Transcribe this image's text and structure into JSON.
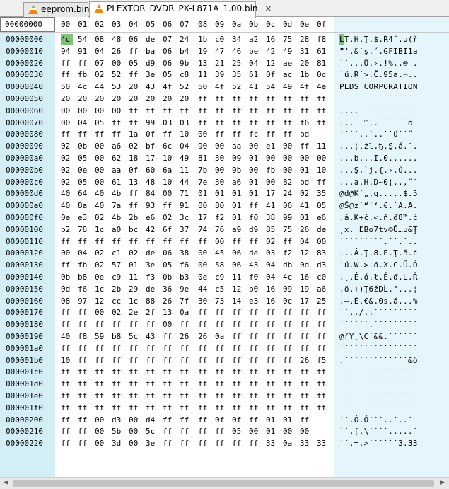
{
  "tabs": [
    {
      "label": "eeprom.bin",
      "icon": "vlc-cone-icon",
      "active": false
    },
    {
      "label": "PLEXTOR_DVDR_PX-L871A_1.00.bin",
      "icon": "vlc-cone-icon",
      "active": true,
      "close": "×"
    }
  ],
  "header": {
    "offset_label": "00000000",
    "columns": [
      "00",
      "01",
      "02",
      "03",
      "04",
      "05",
      "06",
      "07",
      "08",
      "09",
      "0a",
      "0b",
      "0c",
      "0d",
      "0e",
      "0f"
    ]
  },
  "cursor": {
    "row": 0,
    "col": 0
  },
  "rows": [
    {
      "offset": "00000000",
      "hex": [
        "4c",
        "54",
        "08",
        "48",
        "06",
        "de",
        "07",
        "24",
        "1b",
        "c0",
        "34",
        "a2",
        "16",
        "75",
        "28",
        "f8"
      ],
      "ascii": "LT.H.Ţ.$.Ŕ4˘.u(ř"
    },
    {
      "offset": "00000010",
      "hex": [
        "94",
        "91",
        "04",
        "26",
        "ff",
        "ba",
        "06",
        "b4",
        "19",
        "47",
        "46",
        "be",
        "42",
        "49",
        "31",
        "61"
      ],
      "ascii": "”‘.&˙ş.´.GFIBI1a"
    },
    {
      "offset": "00000020",
      "hex": [
        "ff",
        "ff",
        "07",
        "00",
        "05",
        "d9",
        "06",
        "9b",
        "13",
        "21",
        "25",
        "04",
        "12",
        "ae",
        "20",
        "81"
      ],
      "ascii": "˙˙...Ů.›.!%..® ."
    },
    {
      "offset": "00000030",
      "hex": [
        "ff",
        "fb",
        "02",
        "52",
        "ff",
        "3e",
        "05",
        "c8",
        "11",
        "39",
        "35",
        "61",
        "0f",
        "ac",
        "1b",
        "0c"
      ],
      "ascii": "˙ű.R˙>.Č.95a.¬.."
    },
    {
      "offset": "00000040",
      "hex": [
        "50",
        "4c",
        "44",
        "53",
        "20",
        "43",
        "4f",
        "52",
        "50",
        "4f",
        "52",
        "41",
        "54",
        "49",
        "4f",
        "4e"
      ],
      "ascii": "PLDS CORPORATION"
    },
    {
      "offset": "00000050",
      "hex": [
        "20",
        "20",
        "20",
        "20",
        "20",
        "20",
        "20",
        "20",
        "ff",
        "ff",
        "ff",
        "ff",
        "ff",
        "ff",
        "ff",
        "ff"
      ],
      "ascii": "        ˙˙˙˙˙˙˙˙"
    },
    {
      "offset": "00000060",
      "hex": [
        "00",
        "00",
        "00",
        "00",
        "ff",
        "ff",
        "ff",
        "ff",
        "ff",
        "ff",
        "ff",
        "ff",
        "ff",
        "ff",
        "ff",
        "ff"
      ],
      "ascii": "....˙˙˙˙˙˙˙˙˙˙˙˙"
    },
    {
      "offset": "00000070",
      "hex": [
        "00",
        "04",
        "05",
        "ff",
        "ff",
        "99",
        "03",
        "03",
        "ff",
        "ff",
        "ff",
        "ff",
        "ff",
        "ff",
        "f6",
        "ff"
      ],
      "ascii": "...˙˙™..˙˙˙˙˙˙ö˙"
    },
    {
      "offset": "00000080",
      "hex": [
        "ff",
        "ff",
        "ff",
        "ff",
        "1a",
        "0f",
        "ff",
        "10",
        "00",
        "ff",
        "ff",
        "fc",
        "ff",
        "ff",
        "bd"
      ],
      "ascii": "˙˙˙˙..˙..˙˙ü˙˙˝"
    },
    {
      "offset": "00000090",
      "hex": [
        "02",
        "0b",
        "00",
        "a6",
        "02",
        "bf",
        "6c",
        "04",
        "90",
        "00",
        "aa",
        "00",
        "e1",
        "00",
        "ff",
        "11"
      ],
      "ascii": "...¦.żl.ђ.Ş.á.˙."
    },
    {
      "offset": "000000a0",
      "hex": [
        "02",
        "05",
        "00",
        "62",
        "18",
        "17",
        "10",
        "49",
        "81",
        "30",
        "09",
        "01",
        "00",
        "00",
        "00",
        "00"
      ],
      "ascii": "...b...I.0......"
    },
    {
      "offset": "000000b0",
      "hex": [
        "02",
        "0e",
        "00",
        "aa",
        "0f",
        "60",
        "6a",
        "11",
        "7b",
        "00",
        "9b",
        "00",
        "fb",
        "00",
        "01",
        "10"
      ],
      "ascii": "...Ş.`j.{.›.ű..."
    },
    {
      "offset": "000000c0",
      "hex": [
        "02",
        "05",
        "00",
        "61",
        "13",
        "48",
        "10",
        "44",
        "7e",
        "30",
        "a6",
        "01",
        "00",
        "82",
        "bd",
        "ff"
      ],
      "ascii": "...a.H.D~0¦..‚˝˙"
    },
    {
      "offset": "000000d0",
      "hex": [
        "40",
        "64",
        "40",
        "4b",
        "ff",
        "84",
        "00",
        "71",
        "01",
        "01",
        "01",
        "01",
        "17",
        "24",
        "02",
        "35"
      ],
      "ascii": "@d@K˙„.q.....$.5"
    },
    {
      "offset": "000000e0",
      "hex": [
        "40",
        "8a",
        "40",
        "7a",
        "ff",
        "93",
        "ff",
        "91",
        "00",
        "80",
        "01",
        "ff",
        "41",
        "06",
        "41",
        "05"
      ],
      "ascii": "@Š@z˙“˙‘.€.˙A.A."
    },
    {
      "offset": "000000f0",
      "hex": [
        "0e",
        "e3",
        "02",
        "4b",
        "2b",
        "e6",
        "02",
        "3c",
        "17",
        "f2",
        "01",
        "f0",
        "38",
        "99",
        "01",
        "e6"
      ],
      "ascii": ".ă.K+ć.<.ň.đ8™.ć"
    },
    {
      "offset": "00000100",
      "hex": [
        "b2",
        "78",
        "1c",
        "a0",
        "bc",
        "42",
        "6f",
        "37",
        "74",
        "76",
        "a9",
        "d9",
        "85",
        "75",
        "26",
        "de"
      ],
      "ascii": "˛x. ĽBo7tv©Ů…u&Ţ"
    },
    {
      "offset": "00000110",
      "hex": [
        "ff",
        "ff",
        "ff",
        "ff",
        "ff",
        "ff",
        "ff",
        "ff",
        "ff",
        "00",
        "ff",
        "ff",
        "02",
        "ff",
        "04",
        "00"
      ],
      "ascii": "˙˙˙˙˙˙˙˙˙.˙˙.˙.."
    },
    {
      "offset": "00000120",
      "hex": [
        "00",
        "04",
        "02",
        "c1",
        "02",
        "de",
        "06",
        "38",
        "00",
        "45",
        "06",
        "de",
        "03",
        "f2",
        "12",
        "83"
      ],
      "ascii": "...Á.Ţ.8.E.Ţ.ň.ѓ"
    },
    {
      "offset": "00000130",
      "hex": [
        "ff",
        "fb",
        "02",
        "57",
        "01",
        "3e",
        "05",
        "f6",
        "00",
        "58",
        "06",
        "43",
        "04",
        "db",
        "0d",
        "d3"
      ],
      "ascii": "˙ű.W.>.ö.X.C.Ű.Ó"
    },
    {
      "offset": "00000140",
      "hex": [
        "0b",
        "b8",
        "0e",
        "c9",
        "11",
        "f3",
        "0b",
        "b3",
        "0e",
        "c9",
        "11",
        "f0",
        "04",
        "4c",
        "16",
        "c0"
      ],
      "ascii": ".¸.É.ó.ł.É.đ.L.Ŕ"
    },
    {
      "offset": "00000150",
      "hex": [
        "0d",
        "f6",
        "1c",
        "2b",
        "29",
        "de",
        "36",
        "9e",
        "44",
        "c5",
        "12",
        "b0",
        "16",
        "09",
        "19",
        "a6"
      ],
      "ascii": ".ö.+)Ţ6žDĹ.°...¦"
    },
    {
      "offset": "00000160",
      "hex": [
        "08",
        "97",
        "12",
        "cc",
        "1c",
        "88",
        "26",
        "7f",
        "30",
        "73",
        "14",
        "e3",
        "16",
        "0c",
        "17",
        "25"
      ],
      "ascii": ".—.Ě.€&.0s.ă...%"
    },
    {
      "offset": "00000170",
      "hex": [
        "ff",
        "ff",
        "00",
        "02",
        "2e",
        "2f",
        "13",
        "0a",
        "ff",
        "ff",
        "ff",
        "ff",
        "ff",
        "ff",
        "ff",
        "ff"
      ],
      "ascii": "˙˙../..˙˙˙˙˙˙˙˙˙"
    },
    {
      "offset": "00000180",
      "hex": [
        "ff",
        "ff",
        "ff",
        "ff",
        "ff",
        "ff",
        "00",
        "ff",
        "ff",
        "ff",
        "ff",
        "ff",
        "ff",
        "ff",
        "ff",
        "ff"
      ],
      "ascii": "˙˙˙˙˙˙.˙˙˙˙˙˙˙˙˙"
    },
    {
      "offset": "00000190",
      "hex": [
        "40",
        "f8",
        "59",
        "b8",
        "5c",
        "43",
        "ff",
        "26",
        "26",
        "0a",
        "ff",
        "ff",
        "ff",
        "ff",
        "ff",
        "ff"
      ],
      "ascii": "@řY¸\\C˙&&.˙˙˙˙˙˙"
    },
    {
      "offset": "000001a0",
      "hex": [
        "ff",
        "ff",
        "ff",
        "ff",
        "ff",
        "ff",
        "ff",
        "ff",
        "ff",
        "ff",
        "ff",
        "ff",
        "ff",
        "ff",
        "ff",
        "ff"
      ],
      "ascii": "˙˙˙˙˙˙˙˙˙˙˙˙˙˙˙˙"
    },
    {
      "offset": "000001b0",
      "hex": [
        "10",
        "ff",
        "ff",
        "ff",
        "ff",
        "ff",
        "ff",
        "ff",
        "ff",
        "ff",
        "ff",
        "ff",
        "ff",
        "ff",
        "26",
        "f5"
      ],
      "ascii": ".˙˙˙˙˙˙˙˙˙˙˙˙˙&ő"
    },
    {
      "offset": "000001c0",
      "hex": [
        "ff",
        "ff",
        "ff",
        "ff",
        "ff",
        "ff",
        "ff",
        "ff",
        "ff",
        "ff",
        "ff",
        "ff",
        "ff",
        "ff",
        "ff",
        "ff"
      ],
      "ascii": "˙˙˙˙˙˙˙˙˙˙˙˙˙˙˙˙"
    },
    {
      "offset": "000001d0",
      "hex": [
        "ff",
        "ff",
        "ff",
        "ff",
        "ff",
        "ff",
        "ff",
        "ff",
        "ff",
        "ff",
        "ff",
        "ff",
        "ff",
        "ff",
        "ff",
        "ff"
      ],
      "ascii": "˙˙˙˙˙˙˙˙˙˙˙˙˙˙˙˙"
    },
    {
      "offset": "000001e0",
      "hex": [
        "ff",
        "ff",
        "ff",
        "ff",
        "ff",
        "ff",
        "ff",
        "ff",
        "ff",
        "ff",
        "ff",
        "ff",
        "ff",
        "ff",
        "ff",
        "ff"
      ],
      "ascii": "˙˙˙˙˙˙˙˙˙˙˙˙˙˙˙˙"
    },
    {
      "offset": "000001f0",
      "hex": [
        "ff",
        "ff",
        "ff",
        "ff",
        "ff",
        "ff",
        "ff",
        "ff",
        "ff",
        "ff",
        "ff",
        "ff",
        "ff",
        "ff",
        "ff",
        "ff"
      ],
      "ascii": "˙˙˙˙˙˙˙˙˙˙˙˙˙˙˙˙"
    },
    {
      "offset": "00000200",
      "hex": [
        "ff",
        "ff",
        "00",
        "d3",
        "00",
        "d4",
        "ff",
        "ff",
        "ff",
        "0f",
        "0f",
        "ff",
        "01",
        "01",
        "ff"
      ],
      "ascii": "˙˙.Ó.Ô˙˙˙..˙..˙"
    },
    {
      "offset": "00000210",
      "hex": [
        "ff",
        "ff",
        "00",
        "5b",
        "00",
        "5c",
        "ff",
        "ff",
        "ff",
        "ff",
        "05",
        "00",
        "01",
        "00",
        "00"
      ],
      "ascii": "˙˙.[.\\˙˙˙˙.....˙"
    },
    {
      "offset": "00000220",
      "hex": [
        "ff",
        "ff",
        "00",
        "3d",
        "00",
        "3e",
        "ff",
        "ff",
        "ff",
        "ff",
        "ff",
        "ff",
        "33",
        "0a",
        "33",
        "33"
      ],
      "ascii": "˙˙.=.>˙˙˙˙˙˙3.33"
    }
  ],
  "colors": {
    "offset_bg": "#d4eef6",
    "ascii_bg": "#e4f6fb",
    "selection": "#7ec478",
    "tab_icon": "#f08a00"
  }
}
